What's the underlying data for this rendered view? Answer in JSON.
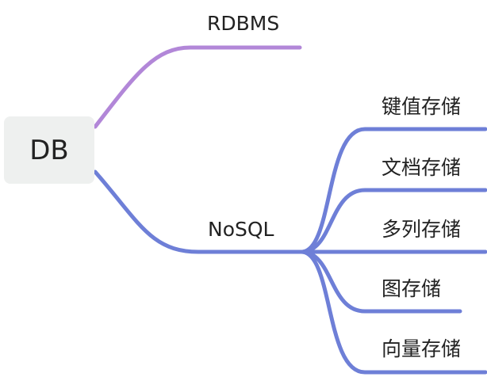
{
  "colors": {
    "branch_rdbms": "#b287d8",
    "branch_nosql": "#6e7fd7",
    "root_background": "#eef0ef",
    "text": "#222222"
  },
  "root": {
    "label": "DB"
  },
  "branches": {
    "rdbms": {
      "label": "RDBMS"
    },
    "nosql": {
      "label": "NoSQL",
      "children": [
        {
          "label": "键值存储"
        },
        {
          "label": "文档存储"
        },
        {
          "label": "多列存储"
        },
        {
          "label": "图存储"
        },
        {
          "label": "向量存储"
        }
      ]
    }
  }
}
